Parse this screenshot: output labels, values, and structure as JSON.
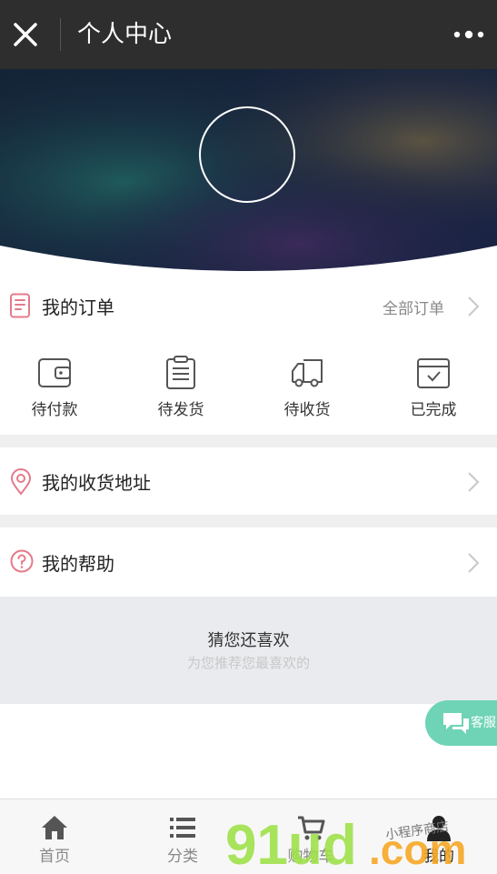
{
  "title_bar": {
    "title": "个人中心",
    "close_icon": "close-icon",
    "more_icon": "more-dots-icon"
  },
  "header": {
    "avatar_icon": "avatar-circle"
  },
  "orders": {
    "label": "我的订单",
    "all_orders": "全部订单",
    "statuses": [
      {
        "label": "待付款",
        "icon": "wallet-icon"
      },
      {
        "label": "待发货",
        "icon": "clipboard-icon"
      },
      {
        "label": "待收货",
        "icon": "truck-icon"
      },
      {
        "label": "已完成",
        "icon": "check-box-icon"
      }
    ]
  },
  "address": {
    "label": "我的收货地址",
    "icon": "location-pin-icon"
  },
  "help": {
    "label": "我的帮助",
    "icon": "question-circle-icon"
  },
  "recommend": {
    "title": "猜您还喜欢",
    "subtitle": "为您推荐您最喜欢的"
  },
  "customer_service": {
    "label": "客服"
  },
  "tab_bar": {
    "tabs": [
      {
        "label": "首页",
        "icon": "home-icon"
      },
      {
        "label": "分类",
        "icon": "list-icon"
      },
      {
        "label": "购物车",
        "icon": "cart-icon"
      },
      {
        "label": "我的",
        "icon": "person-icon"
      }
    ],
    "active": "我的"
  },
  "watermark": {
    "text": "91ud.com",
    "small_text": "小程序商店"
  },
  "colors": {
    "accent_pink": "#e57a8a",
    "service_green": "#6fd4b6",
    "titlebar": "#2e2e2e"
  }
}
